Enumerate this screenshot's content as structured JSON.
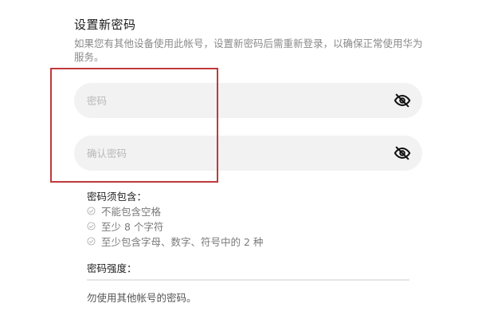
{
  "header": {
    "title": "设置新密码",
    "description": "如果您有其他设备使用此帐号，设置新密码后需重新登录，以确保正常使用华为服务。"
  },
  "password_field": {
    "placeholder": "密码",
    "value": "",
    "icon": "eye-slash-icon"
  },
  "confirm_field": {
    "placeholder": "确认密码",
    "value": "",
    "icon": "eye-slash-icon"
  },
  "requirements": {
    "title": "密码须包含：",
    "items": [
      "不能包含空格",
      "至少 8 个字符",
      "至少包含字母、数字、符号中的 2 种"
    ]
  },
  "strength": {
    "label": "密码强度：",
    "level": 0
  },
  "hint": "勿使用其他帐号的密码。",
  "colors": {
    "highlight": "#c0393b",
    "field_bg": "#f2f2f2",
    "muted_text": "#8a8a8a"
  }
}
